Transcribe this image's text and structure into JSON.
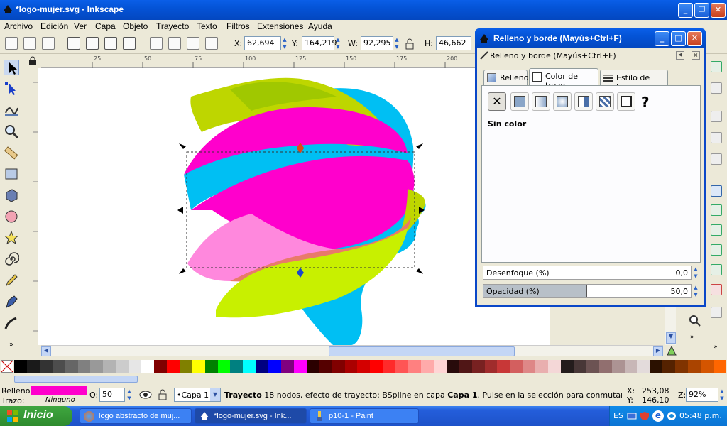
{
  "window": {
    "title": "*logo-mujer.svg - Inkscape"
  },
  "menu": {
    "items": [
      "Archivo",
      "Edición",
      "Ver",
      "Capa",
      "Objeto",
      "Trayecto",
      "Texto",
      "Filtros",
      "Extensiones",
      "Ayuda"
    ]
  },
  "coords": {
    "x_label": "X:",
    "x_value": "62,694",
    "y_label": "Y:",
    "y_value": "164,219",
    "w_label": "W:",
    "w_value": "92,295",
    "h_label": "H:",
    "h_value": "46,662"
  },
  "ruler": {
    "ticks": [
      "25",
      "50",
      "75",
      "100",
      "125",
      "150",
      "175",
      "200",
      "225"
    ]
  },
  "dialog": {
    "title": "Relleno y borde (Mayús+Ctrl+F)",
    "subtitle": "Relleno y borde (Mayús+Ctrl+F)",
    "tabs": [
      "Relleno",
      "Color de trazo",
      "Estilo de trazo"
    ],
    "paint_none_label": "Sin color",
    "unknown_glyph": "?",
    "blur_label": "Desenfoque (%)",
    "blur_value": "0,0",
    "opacity_label": "Opacidad (%)",
    "opacity_value": "50,0",
    "opacity_fraction": 0.5
  },
  "status": {
    "fill_label": "Relleno:",
    "stroke_label": "Trazo:",
    "fill_color": "#ff00cc",
    "stroke_value": "Ninguno",
    "opacity_label": "O:",
    "opacity_value": "50",
    "layer": "•Capa 1",
    "message_bold": "Trayecto",
    "message": " 18 nodos, efecto de trayecto: BSpline en capa ",
    "message_layer": "Capa 1",
    "message_tail": ". Pulse en la selección para conmutar los tiradores...",
    "x_label": "X:",
    "x_value": "253,08",
    "y_label": "Y:",
    "y_value": "146,10",
    "zoom_label": "Z:",
    "zoom_value": "92%"
  },
  "taskbar": {
    "start": "Inicio",
    "items": [
      "logo abstracto de muj...",
      "*logo-mujer.svg - Ink...",
      "p10-1 - Paint"
    ],
    "lang": "ES",
    "time": "05:48 p.m."
  },
  "palette_colors": [
    "#000000",
    "#1a1a1a",
    "#333333",
    "#4d4d4d",
    "#666666",
    "#808080",
    "#999999",
    "#b3b3b3",
    "#cccccc",
    "#e6e6e6",
    "#ffffff",
    "#800000",
    "#ff0000",
    "#808000",
    "#ffff00",
    "#008000",
    "#00ff00",
    "#008080",
    "#00ffff",
    "#000080",
    "#0000ff",
    "#800080",
    "#ff00ff",
    "#2b0000",
    "#550000",
    "#800000",
    "#aa0000",
    "#d40000",
    "#ff0000",
    "#ff2a2a",
    "#ff5555",
    "#ff8080",
    "#ffaaaa",
    "#ffd5d5",
    "#280b0b",
    "#501616",
    "#782121",
    "#a02c2c",
    "#c83737",
    "#d35f5f",
    "#de8787",
    "#e9afaf",
    "#f4d7d7",
    "#241c1c",
    "#483737",
    "#6c5353",
    "#916f6f",
    "#ac9393",
    "#c8b7b7",
    "#e3dbdb",
    "#2b1100",
    "#552200",
    "#803300",
    "#aa4400",
    "#d45500",
    "#ff6600"
  ]
}
